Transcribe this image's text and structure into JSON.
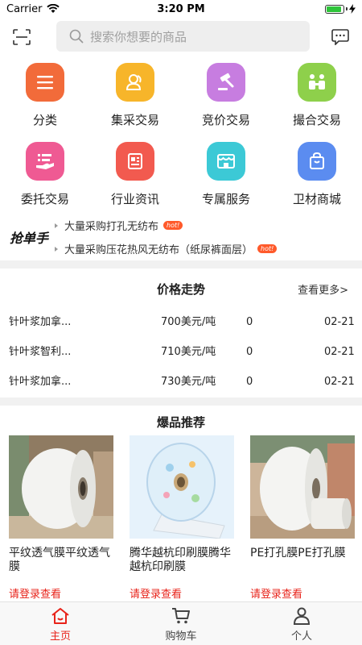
{
  "status_bar": {
    "carrier": "Carrier",
    "time": "3:20 PM",
    "battery_level": 0.9
  },
  "search": {
    "placeholder": "搜索你想要的商品"
  },
  "grid": [
    {
      "label": "分类",
      "icon": "list-icon",
      "color": "#f26b3a"
    },
    {
      "label": "集采交易",
      "icon": "group-buy-icon",
      "color": "#f7b52a"
    },
    {
      "label": "竞价交易",
      "icon": "gavel-icon",
      "color": "#c77de0"
    },
    {
      "label": "撮合交易",
      "icon": "match-icon",
      "color": "#8ed04b"
    },
    {
      "label": "委托交易",
      "icon": "entrust-icon",
      "color": "#ef5a93"
    },
    {
      "label": "行业资讯",
      "icon": "news-icon",
      "color": "#f25a4f"
    },
    {
      "label": "专属服务",
      "icon": "store-icon",
      "color": "#3cc9d6"
    },
    {
      "label": "卫材商城",
      "icon": "bag-icon",
      "color": "#5b8cf0"
    }
  ],
  "qiang": {
    "title": "抢单手",
    "items": [
      {
        "text": "大量采购打孔无纺布",
        "badge": "hot!"
      },
      {
        "text": "大量采购压花热风无纺布（纸尿裤面层）",
        "badge": "hot!"
      }
    ]
  },
  "price": {
    "title": "价格走势",
    "more": "查看更多>",
    "rows": [
      {
        "name": "针叶浆加拿...",
        "price": "700美元/吨",
        "change": "0",
        "date": "02-21"
      },
      {
        "name": "针叶浆智利...",
        "price": "710美元/吨",
        "change": "0",
        "date": "02-21"
      },
      {
        "name": "针叶浆加拿...",
        "price": "730美元/吨",
        "change": "0",
        "date": "02-21"
      }
    ]
  },
  "hot": {
    "title": "爆品推荐",
    "products": [
      {
        "name": "平纹透气膜平纹透气膜",
        "login": "请登录查看"
      },
      {
        "name": "腾华越杭印刷膜腾华越杭印刷膜",
        "login": "请登录查看"
      },
      {
        "name": "PE打孔膜PE打孔膜",
        "login": "请登录查看"
      }
    ]
  },
  "tabbar": {
    "active_color": "#e8231a",
    "tabs": [
      {
        "label": "主页",
        "icon": "home-icon"
      },
      {
        "label": "购物车",
        "icon": "cart-icon"
      },
      {
        "label": "个人",
        "icon": "person-icon"
      }
    ]
  }
}
